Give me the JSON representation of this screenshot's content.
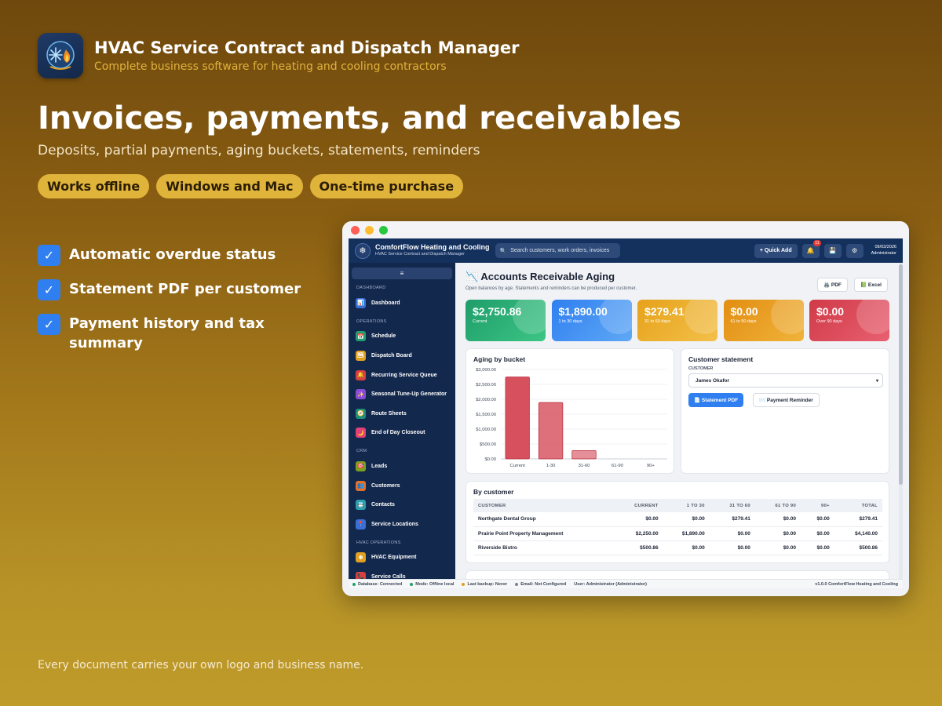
{
  "brand": {
    "title": "HVAC Service Contract and Dispatch Manager",
    "subtitle": "Complete business software for heating and cooling contractors"
  },
  "hero": {
    "title": "Invoices, payments, and receivables",
    "subtitle": "Deposits, partial payments, aging buckets, statements, reminders"
  },
  "pills": [
    "Works offline",
    "Windows and Mac",
    "One-time purchase"
  ],
  "features": [
    "Automatic overdue status",
    "Statement PDF per customer",
    "Payment history and tax summary"
  ],
  "footer_note": "Every document carries your own logo and business name.",
  "app": {
    "header": {
      "name": "ComfortFlow Heating and Cooling",
      "tagline": "HVAC Service Contract and Dispatch Manager",
      "search_placeholder": "Search customers, work orders, invoices",
      "quick_add": "+ Quick Add",
      "notifications_count": "11",
      "date": "09/03/2026",
      "user": "Administrator"
    },
    "sidebar": {
      "toggle": "≡",
      "sections": [
        {
          "title": "DASHBOARD",
          "items": [
            {
              "label": "Dashboard",
              "icon": "chart-icon",
              "color": "#3b6fd8"
            }
          ]
        },
        {
          "title": "OPERATIONS",
          "items": [
            {
              "label": "Schedule",
              "icon": "calendar-icon",
              "color": "#20a070"
            },
            {
              "label": "Dispatch Board",
              "icon": "map-icon",
              "color": "#e0a020"
            },
            {
              "label": "Recurring Service Queue",
              "icon": "bell-icon",
              "color": "#d84040"
            },
            {
              "label": "Seasonal Tune-Up Generator",
              "icon": "sparkle-icon",
              "color": "#8a4bd8"
            },
            {
              "label": "Route Sheets",
              "icon": "compass-icon",
              "color": "#1f8f7a"
            },
            {
              "label": "End of Day Closeout",
              "icon": "moon-icon",
              "color": "#e0407a"
            }
          ]
        },
        {
          "title": "CRM",
          "items": [
            {
              "label": "Leads",
              "icon": "target-icon",
              "color": "#7aa020"
            },
            {
              "label": "Customers",
              "icon": "people-icon",
              "color": "#e0702a"
            },
            {
              "label": "Contacts",
              "icon": "contact-icon",
              "color": "#2aa0b0"
            },
            {
              "label": "Service Locations",
              "icon": "pin-icon",
              "color": "#3b6fd8"
            }
          ]
        },
        {
          "title": "HVAC OPERATIONS",
          "items": [
            {
              "label": "HVAC Equipment",
              "icon": "snowflake-icon",
              "color": "#e0a020"
            },
            {
              "label": "Service Calls",
              "icon": "phone-icon",
              "color": "#d84040"
            }
          ]
        }
      ]
    },
    "page": {
      "icon": "📉",
      "title": "Accounts Receivable Aging",
      "subtitle": "Open balances by age. Statements and reminders can be produced per customer.",
      "pdf_button": "🖨️ PDF",
      "excel_button": "📗 Excel"
    },
    "kpis": [
      {
        "value": "$2,750.86",
        "label": "Current",
        "color1": "#1f9d6a",
        "color2": "#3cc585"
      },
      {
        "value": "$1,890.00",
        "label": "1 to 30 days",
        "color1": "#2f7ff0",
        "color2": "#5fa8f5"
      },
      {
        "value": "$279.41",
        "label": "31 to 60 days",
        "color1": "#e6a21a",
        "color2": "#f3c04a"
      },
      {
        "value": "$0.00",
        "label": "61 to 90 days",
        "color1": "#e28e12",
        "color2": "#f0b33a"
      },
      {
        "value": "$0.00",
        "label": "Over 90 days",
        "color1": "#d03a48",
        "color2": "#e86070"
      }
    ],
    "chart_card_title": "Aging by bucket",
    "chart_data": {
      "type": "bar",
      "title": "Aging by bucket",
      "categories": [
        "Current",
        "1-30",
        "31-60",
        "61-90",
        "90+"
      ],
      "values": [
        2750.86,
        1890.0,
        279.41,
        0,
        0
      ],
      "ylim": [
        0,
        3000
      ],
      "yticks": [
        "$0.00",
        "$500.00",
        "$1,000.00",
        "$1,500.00",
        "$2,000.00",
        "$2,500.00",
        "$3,000.00"
      ],
      "ytick_values": [
        0,
        500,
        1000,
        1500,
        2000,
        2500,
        3000
      ],
      "grid": true,
      "bar_color": "#d7505e"
    },
    "statement": {
      "title": "Customer statement",
      "customer_label": "CUSTOMER",
      "selected_customer": "James Okafor",
      "statement_pdf": "📄 Statement PDF",
      "payment_reminder": "✉️ Payment Reminder"
    },
    "by_customer": {
      "title": "By customer",
      "columns": [
        "CUSTOMER",
        "CURRENT",
        "1 TO 30",
        "31 TO 60",
        "61 TO 90",
        "90+",
        "TOTAL"
      ],
      "rows": [
        [
          "Northgate Dental Group",
          "$0.00",
          "$0.00",
          "$279.41",
          "$0.00",
          "$0.00",
          "$279.41"
        ],
        [
          "Prairie Point Property Management",
          "$2,250.00",
          "$1,890.00",
          "$0.00",
          "$0.00",
          "$0.00",
          "$4,140.00"
        ],
        [
          "Riverside Bistro",
          "$500.86",
          "$0.00",
          "$0.00",
          "$0.00",
          "$0.00",
          "$500.86"
        ]
      ]
    },
    "statusbar": {
      "items": [
        {
          "text": "Database: Connected",
          "color": "#22a06b"
        },
        {
          "text": "Mode: Offline local",
          "color": "#22a06b"
        },
        {
          "text": "Last backup: Never",
          "color": "#e0a020"
        },
        {
          "text": "Email: Not Configured",
          "color": "#7a8494"
        }
      ],
      "user": "User: Administrator (Administrator)",
      "version": "v1.0.0 ComfortFlow Heating and Cooling"
    }
  }
}
